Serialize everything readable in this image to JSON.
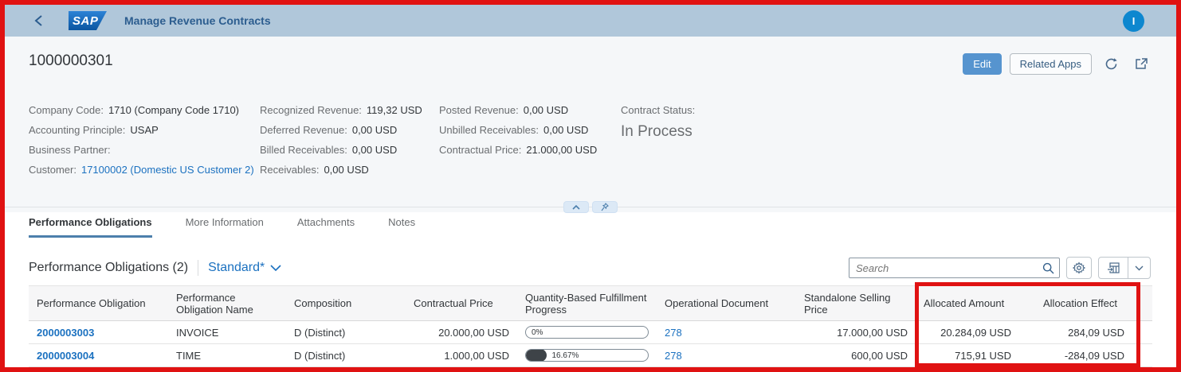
{
  "shell": {
    "logo_text": "SAP",
    "title": "Manage Revenue Contracts",
    "avatar_initial": "I"
  },
  "header": {
    "object_id": "1000000301",
    "edit_label": "Edit",
    "related_apps_label": "Related Apps",
    "attributes": {
      "col1": [
        {
          "label": "Company Code:",
          "value": "1710 (Company Code 1710)"
        },
        {
          "label": "Accounting Principle:",
          "value": "USAP"
        },
        {
          "label": "Business Partner:",
          "value": ""
        },
        {
          "label": "Customer:",
          "value": "17100002 (Domestic US Customer 2)"
        }
      ],
      "col2": [
        {
          "label": "Recognized Revenue:",
          "value": "119,32 USD"
        },
        {
          "label": "Deferred Revenue:",
          "value": "0,00 USD"
        },
        {
          "label": "Billed Receivables:",
          "value": "0,00 USD"
        },
        {
          "label": "Receivables:",
          "value": "0,00 USD"
        }
      ],
      "col3": [
        {
          "label": "Posted Revenue:",
          "value": "0,00 USD"
        },
        {
          "label": "Unbilled Receivables:",
          "value": "0,00 USD"
        },
        {
          "label": "Contractual Price:",
          "value": "21.000,00 USD"
        }
      ]
    },
    "status": {
      "label": "Contract Status:",
      "value": "In Process"
    }
  },
  "tabs": [
    {
      "label": "Performance Obligations",
      "active": true
    },
    {
      "label": "More Information",
      "active": false
    },
    {
      "label": "Attachments",
      "active": false
    },
    {
      "label": "Notes",
      "active": false
    }
  ],
  "table": {
    "title": "Performance Obligations (2)",
    "view": "Standard*",
    "search_placeholder": "Search",
    "columns": [
      {
        "label": "Performance Obligation"
      },
      {
        "label": "Performance Obligation Name"
      },
      {
        "label": "Composition"
      },
      {
        "label": "Contractual Price"
      },
      {
        "label": "Quantity-Based Fulfillment Progress"
      },
      {
        "label": "Operational Document"
      },
      {
        "label": "Standalone Selling Price"
      },
      {
        "label": "Allocated Amount"
      },
      {
        "label": "Allocation Effect"
      }
    ],
    "rows": [
      {
        "performance_obligation": "2000003003",
        "name": "INVOICE",
        "composition": "D (Distinct)",
        "contractual_price": "20.000,00 USD",
        "progress_percent": 0,
        "progress_label": "0%",
        "operational_document": "278",
        "standalone_selling_price": "17.000,00 USD",
        "allocated_amount": "20.284,09 USD",
        "allocation_effect": "284,09 USD"
      },
      {
        "performance_obligation": "2000003004",
        "name": "TIME",
        "composition": "D (Distinct)",
        "contractual_price": "1.000,00 USD",
        "progress_percent": 16.67,
        "progress_label": "16.67%",
        "operational_document": "278",
        "standalone_selling_price": "600,00 USD",
        "allocated_amount": "715,91 USD",
        "allocation_effect": "-284,09 USD"
      }
    ]
  },
  "annotation": {
    "highlight_color": "#e01212"
  },
  "colors": {
    "shell_bg": "#b0c7da",
    "accent_link": "#1b71c0",
    "primary_button": "#5694cf"
  }
}
